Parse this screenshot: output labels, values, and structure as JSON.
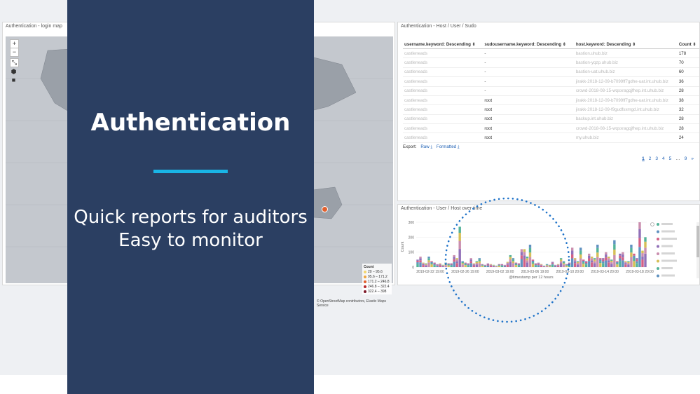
{
  "map_panel": {
    "title": "Authentication - login map",
    "zoom_in": "+",
    "zoom_out": "−",
    "legend": {
      "title": "Count",
      "ranges": [
        {
          "label": "20 – 95.6",
          "color": "#f3d56c"
        },
        {
          "label": "95.6 – 171.2",
          "color": "#f0a43d"
        },
        {
          "label": "171.2 – 246.8",
          "color": "#e2602d"
        },
        {
          "label": "246.8 – 322.4",
          "color": "#b5292d"
        },
        {
          "label": "322.4 – 398",
          "color": "#7e1a2a"
        }
      ]
    },
    "attribution": "© OpenStreetMap contributors, Elastic Maps Service"
  },
  "table_panel": {
    "title": "Authentication - Host / User / Sudo",
    "columns": [
      "username.keyword: Descending ⇕",
      "sudousername.keyword: Descending ⇕",
      "host.keyword: Descending ⇕",
      "Count ⇕"
    ],
    "rows": [
      {
        "user": "castleneads",
        "sudo": "-",
        "host": "bastion.uhub.biz",
        "count": "178"
      },
      {
        "user": "castleneads",
        "sudo": "-",
        "host": "bastion-yqzp.uhub.biz",
        "count": "70"
      },
      {
        "user": "castleneads",
        "sudo": "-",
        "host": "bastion-uat.uhub.biz",
        "count": "60"
      },
      {
        "user": "castleneads",
        "sudo": "-",
        "host": "jirakk-2018-12-09-b7099ff7gdhe-uat.int.uhub.biz",
        "count": "36"
      },
      {
        "user": "castleneads",
        "sudo": "-",
        "host": "crowd-2018-08-15-wqsxragqjfhep.int.uhub.biz",
        "count": "28"
      },
      {
        "user": "castleneads",
        "sudo": "root",
        "host": "jirakk-2018-12-09-b7099ff7gdhe-uat.int.uhub.biz",
        "count": "38"
      },
      {
        "user": "castleneads",
        "sudo": "root",
        "host": "jirakk-2018-12-09-f9gudfsxmgd.int.uhub.biz",
        "count": "32"
      },
      {
        "user": "castleneads",
        "sudo": "root",
        "host": "backup.int.uhub.biz",
        "count": "28"
      },
      {
        "user": "castleneads",
        "sudo": "root",
        "host": "crowd-2018-08-15-wqsxragqjfhep.int.uhub.biz",
        "count": "28"
      },
      {
        "user": "castleneads",
        "sudo": "root",
        "host": "my.uhub.biz",
        "count": "24"
      }
    ],
    "export_label": "Export:",
    "export_raw": "Raw ⤓",
    "export_formatted": "Formatted ⤓",
    "pages": [
      "1",
      "2",
      "3",
      "4",
      "5",
      "…",
      "9",
      "»"
    ]
  },
  "hist_panel": {
    "title": "Authentication - User / Host over time",
    "x_label": "@timestamp per 12 hours",
    "y_label": "Count"
  },
  "chart_data": {
    "type": "bar",
    "title": "Authentication - User / Host over time",
    "xlabel": "@timestamp per 12 hours",
    "ylabel": "Count",
    "ylim": [
      0,
      300
    ],
    "y_ticks": [
      0,
      100,
      200,
      300
    ],
    "x_ticks": [
      "2019-02-22 19:00",
      "2019-02-26 19:00",
      "2019-03-02 19:00",
      "2019-03-06 19:00",
      "2019-03-10 20:00",
      "2019-03-14 20:00",
      "2019-03-18 20:00"
    ],
    "values": [
      50,
      70,
      30,
      25,
      70,
      40,
      30,
      20,
      25,
      15,
      30,
      25,
      25,
      80,
      60,
      270,
      40,
      30,
      25,
      60,
      25,
      40,
      60,
      20,
      15,
      25,
      20,
      15,
      10,
      20,
      20,
      15,
      35,
      80,
      60,
      30,
      25,
      120,
      120,
      70,
      150,
      50,
      25,
      30,
      20,
      10,
      20,
      15,
      35,
      15,
      20,
      60,
      40,
      20,
      30,
      130,
      60,
      40,
      130,
      50,
      40,
      90,
      70,
      60,
      150,
      60,
      60,
      100,
      70,
      50,
      180,
      40,
      90,
      100,
      40,
      40,
      150,
      90,
      60,
      300,
      110,
      200
    ],
    "legend_placement": "right"
  },
  "overlay": {
    "title": "Authentication",
    "line1": "Quick reports for auditors",
    "line2": "Easy to monitor",
    "accent": "#19b5e6",
    "background": "#2b3f62"
  }
}
